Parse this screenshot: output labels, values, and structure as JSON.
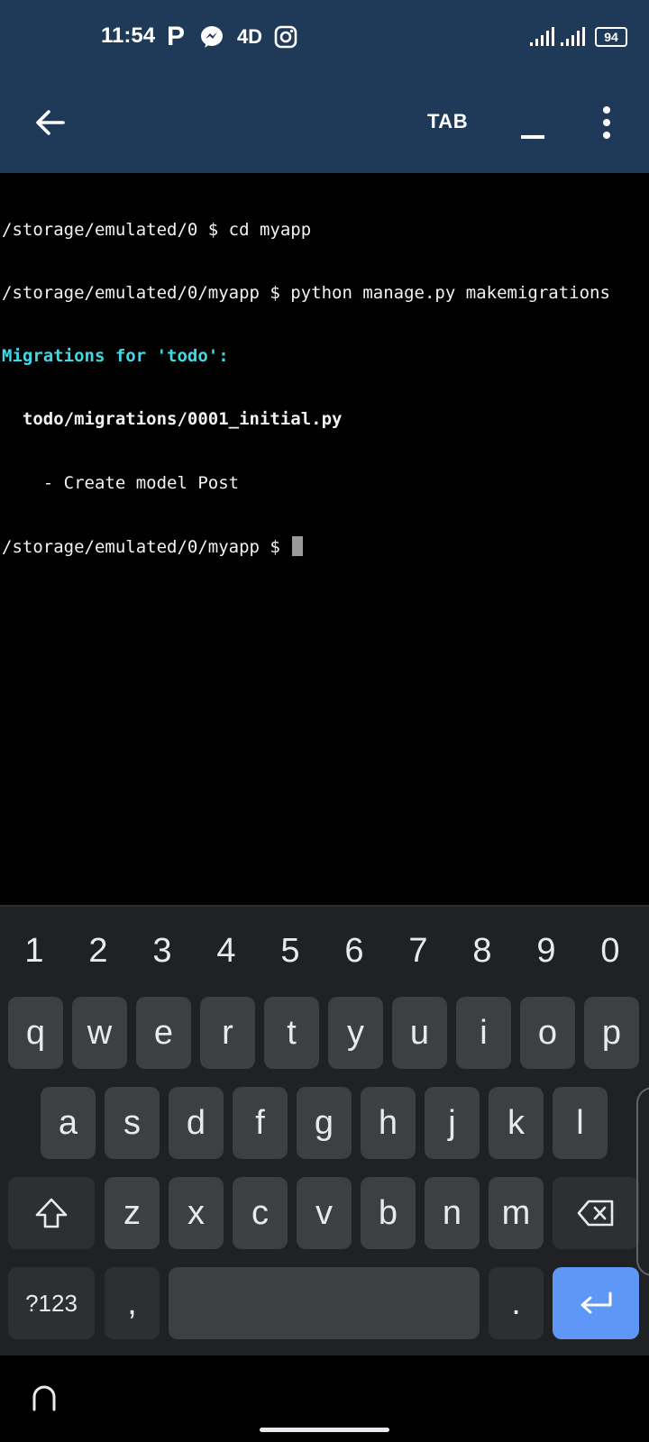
{
  "status_bar": {
    "time": "11:54",
    "p_label": "P",
    "d4_label": "4D",
    "battery": "94"
  },
  "app_bar": {
    "tab_label": "TAB"
  },
  "terminal": {
    "lines": [
      "/storage/emulated/0 $ cd myapp",
      "/storage/emulated/0/myapp $ python manage.py makemigrations",
      "Migrations for 'todo':",
      "  todo/migrations/0001_initial.py",
      "    - Create model Post",
      "/storage/emulated/0/myapp $ "
    ]
  },
  "keyboard": {
    "numbers": [
      "1",
      "2",
      "3",
      "4",
      "5",
      "6",
      "7",
      "8",
      "9",
      "0"
    ],
    "row1": [
      "q",
      "w",
      "e",
      "r",
      "t",
      "y",
      "u",
      "i",
      "o",
      "p"
    ],
    "row2": [
      "a",
      "s",
      "d",
      "f",
      "g",
      "h",
      "j",
      "k",
      "l"
    ],
    "row3": [
      "z",
      "x",
      "c",
      "v",
      "b",
      "n",
      "m"
    ],
    "symbols_label": "?123",
    "comma": ",",
    "period": "."
  },
  "colors": {
    "app_bar": "#1f3a58",
    "terminal_bg": "#000000",
    "terminal_highlight": "#3fd9e6",
    "enter_key": "#5e97f6"
  }
}
